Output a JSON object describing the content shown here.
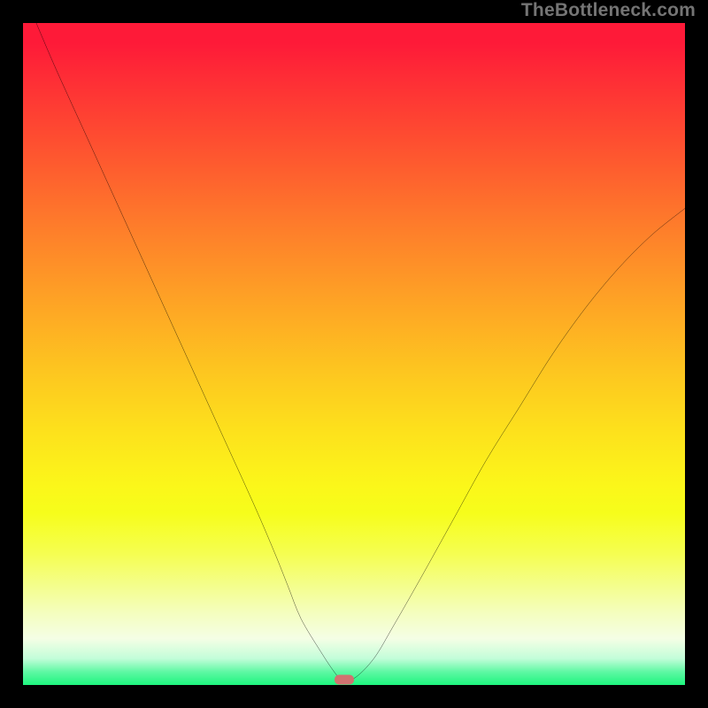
{
  "watermark": "TheBottleneck.com",
  "chart_data": {
    "type": "line",
    "title": "",
    "xlabel": "",
    "ylabel": "",
    "xlim": [
      0,
      100
    ],
    "ylim": [
      0,
      100
    ],
    "grid": false,
    "legend": false,
    "background_gradient": {
      "stops": [
        {
          "pos": 0,
          "color": "#fe1a38"
        },
        {
          "pos": 18,
          "color": "#fe4f30"
        },
        {
          "pos": 42,
          "color": "#fea325"
        },
        {
          "pos": 62,
          "color": "#fde21c"
        },
        {
          "pos": 80,
          "color": "#f5fe4f"
        },
        {
          "pos": 93,
          "color": "#f4fee5"
        },
        {
          "pos": 100,
          "color": "#1ef57e"
        }
      ]
    },
    "series": [
      {
        "name": "bottleneck-curve",
        "color": "#000000",
        "x": [
          2,
          5,
          10,
          15,
          20,
          25,
          30,
          35,
          38,
          40,
          42,
          45,
          47,
          48,
          50,
          53,
          56,
          60,
          65,
          70,
          75,
          80,
          85,
          90,
          95,
          100
        ],
        "y": [
          100,
          93,
          82,
          71,
          60,
          49,
          38,
          27,
          20,
          15,
          10,
          5,
          2,
          1,
          1,
          4,
          9,
          16,
          25,
          34,
          42,
          50,
          57,
          63,
          68,
          72
        ]
      }
    ],
    "annotations": [
      {
        "name": "sweet-spot-marker",
        "x": 48.5,
        "y": 0.8,
        "color": "#d17270",
        "shape": "rounded-rect"
      }
    ]
  }
}
